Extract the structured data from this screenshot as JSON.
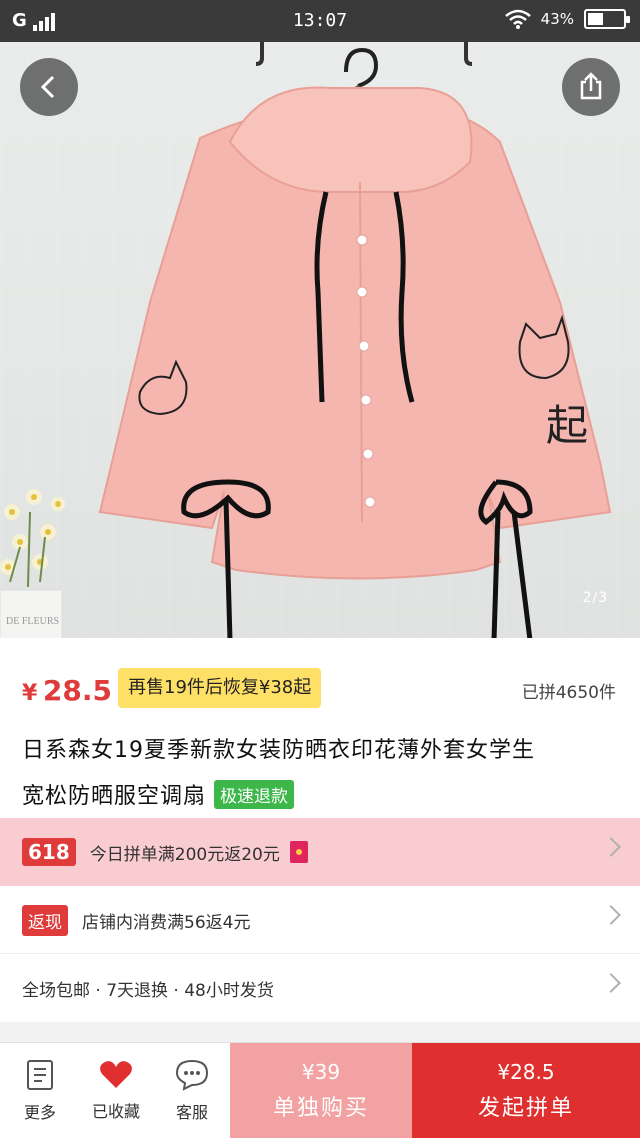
{
  "status_bar": {
    "carrier": "G",
    "time": "13:07",
    "battery_text": "43%",
    "battery_level": 0.43
  },
  "gallery": {
    "page_indicator": "2/3"
  },
  "product": {
    "currency": "¥",
    "price": "28.5",
    "restore_badge": "再售19件后恢复¥38起",
    "sold": "已拼4650件",
    "title_line1": "日系森女19夏季新款女装防晒衣印花薄外套女学生",
    "title_line2": "宽松防晒服空调扇",
    "fast_refund_tag": "极速退款"
  },
  "promotions": {
    "promo618_tag": "618",
    "promo618_text": "今日拼单满200元返20元",
    "cashback_tag": "返现",
    "cashback_text": "店铺内消费满56返4元",
    "service_text": "全场包邮 · 7天退换 · 48小时发货"
  },
  "bottom_bar": {
    "more_label": "更多",
    "fav_label": "已收藏",
    "service_label": "客服",
    "buy_alone_price": "¥39",
    "buy_alone_label": "单独购买",
    "buy_group_price": "¥28.5",
    "buy_group_label": "发起拼单"
  },
  "colors": {
    "accent_red": "#e03b3b",
    "jacket_pink": "#f4b6ae",
    "badge_yellow": "#ffe066",
    "tag_green": "#3db64a"
  }
}
